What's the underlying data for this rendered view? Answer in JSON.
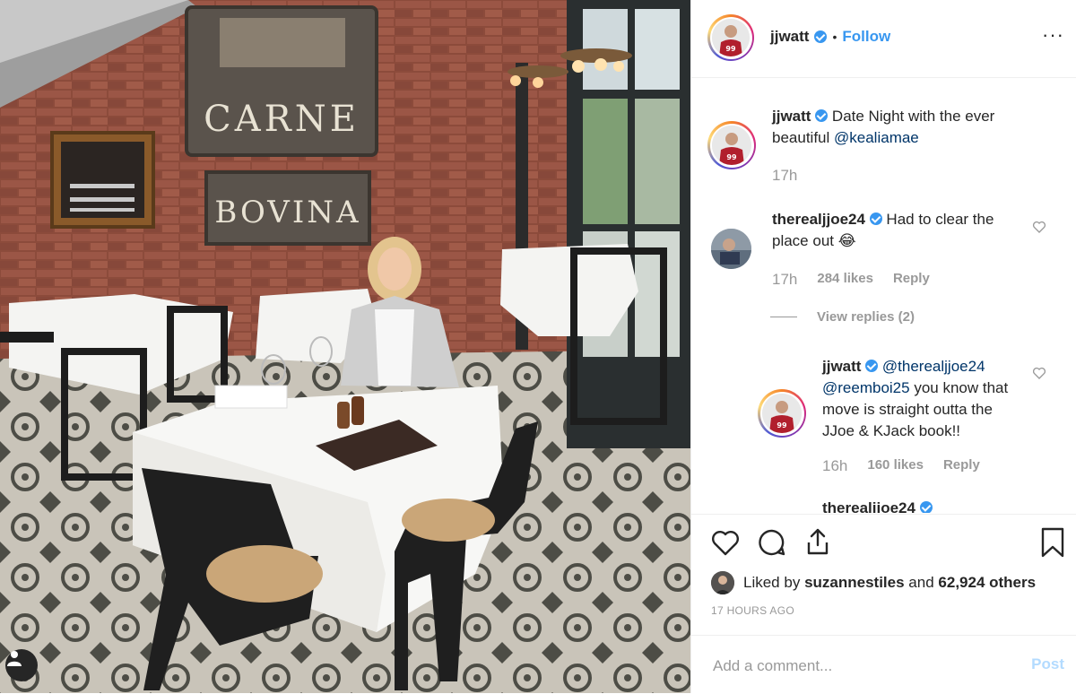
{
  "photo": {
    "sign_line1": "CARNE",
    "sign_line2": "BOVINA"
  },
  "header": {
    "username": "jjwatt",
    "separator": "•",
    "follow_label": "Follow",
    "more_icon": "more-horizontal-icon"
  },
  "comments": [
    {
      "username": "jjwatt",
      "text": "Date Night with the ever beautiful",
      "mention": "@kealiamae",
      "time": "17h"
    },
    {
      "username": "therealjjoe24",
      "text": "Had to clear the place out",
      "emoji": "😂",
      "time": "17h",
      "likes": "284 likes",
      "reply_label": "Reply"
    }
  ],
  "view_replies": "View replies (2)",
  "reply": {
    "username": "jjwatt",
    "mention1": "@therealjjoe24",
    "mention2": "@reemboi25",
    "text": "you know that move is straight outta the JJoe & KJack book!!",
    "time": "16h",
    "likes": "160 likes",
    "reply_label": "Reply"
  },
  "cut_comment_username": "therealjjoe24",
  "likes": {
    "prefix": "Liked by",
    "user": "suzannestiles",
    "and": "and",
    "others": "62,924 others"
  },
  "post_time": "17 HOURS AGO",
  "add_comment": {
    "placeholder": "Add a comment...",
    "post_label": "Post"
  },
  "colors": {
    "link_blue": "#3897f0",
    "mention_blue": "#003569",
    "muted": "#999999"
  }
}
